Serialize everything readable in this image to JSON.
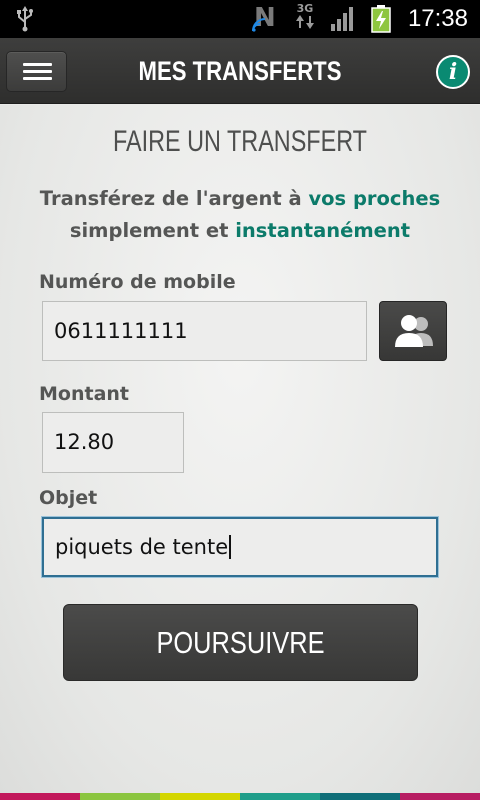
{
  "status_bar": {
    "time": "17:38",
    "network_type": "3G",
    "notification_letter": "N"
  },
  "header": {
    "title": "MES TRANSFERTS"
  },
  "form": {
    "section_title": "FAIRE UN TRANSFERT",
    "intro_part1": "Transférez de l'argent à ",
    "intro_accent1": "vos proches",
    "intro_part2": "simplement et ",
    "intro_accent2": "instantanément",
    "mobile_label": "Numéro de mobile",
    "mobile_value": "0611111111",
    "amount_label": "Montant",
    "amount_value": "12.80",
    "object_label": "Objet",
    "object_value": "piquets de tente",
    "submit_label": "POURSUIVRE"
  },
  "colors": {
    "accent": "#0c7b6a",
    "info_button": "#0a8a72",
    "focus_border": "#2f6f92",
    "battery": "#8ec63f",
    "strip": [
      "#c2185b",
      "#8bc53f",
      "#d4d600",
      "#1f9e8a",
      "#0f6e78",
      "#b71d62"
    ]
  },
  "icons": {
    "status_usb": "usb-icon",
    "status_wifi": "wifi-icon",
    "status_signal": "signal-bars-icon",
    "status_battery": "battery-charging-icon",
    "menu": "hamburger-menu-icon",
    "info": "info-icon",
    "contacts": "contacts-icon"
  }
}
